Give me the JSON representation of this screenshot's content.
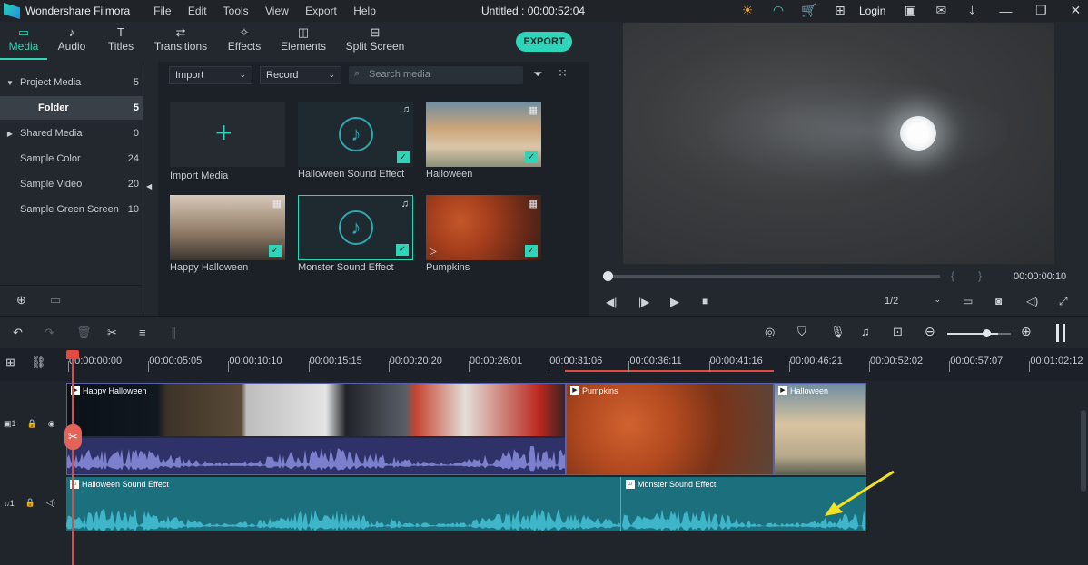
{
  "titlebar": {
    "app_name": "Wondershare Filmora",
    "menu": [
      "File",
      "Edit",
      "Tools",
      "View",
      "Export",
      "Help"
    ],
    "document": "Untitled : 00:00:52:04",
    "login": "Login"
  },
  "tabs": [
    {
      "label": "Media",
      "icon": "folder-icon"
    },
    {
      "label": "Audio",
      "icon": "music-note-icon"
    },
    {
      "label": "Titles",
      "icon": "text-icon"
    },
    {
      "label": "Transitions",
      "icon": "transition-icon"
    },
    {
      "label": "Effects",
      "icon": "effects-icon"
    },
    {
      "label": "Elements",
      "icon": "elements-icon"
    },
    {
      "label": "Split Screen",
      "icon": "split-screen-icon"
    }
  ],
  "export_label": "EXPORT",
  "sidebar": {
    "items": [
      {
        "label": "Project Media",
        "count": "5"
      },
      {
        "label": "Folder",
        "count": "5"
      },
      {
        "label": "Shared Media",
        "count": "0"
      },
      {
        "label": "Sample Color",
        "count": "24"
      },
      {
        "label": "Sample Video",
        "count": "20"
      },
      {
        "label": "Sample Green Screen",
        "count": "10"
      }
    ]
  },
  "media_toolbar": {
    "import_label": "Import",
    "record_label": "Record",
    "search_placeholder": "Search media"
  },
  "media": [
    {
      "label": "Import Media"
    },
    {
      "label": "Halloween Sound Effect"
    },
    {
      "label": "Halloween"
    },
    {
      "label": "Happy Halloween"
    },
    {
      "label": "Monster Sound Effect"
    },
    {
      "label": "Pumpkins"
    }
  ],
  "preview": {
    "time": "00:00:00:10",
    "quality": "1/2",
    "progress_fraction": 0.01
  },
  "ruler_ticks": [
    "00:00:00:00",
    "00:00:05:05",
    "00:00:10:10",
    "00:00:15:15",
    "00:00:20:20",
    "00:00:26:01",
    "00:00:31:06",
    "00:00:36:11",
    "00:00:41:16",
    "00:00:46:21",
    "00:00:52:02",
    "00:00:57:07",
    "00:01:02:12"
  ],
  "timeline": {
    "video_track_label": "1",
    "audio_track_label": "1",
    "video_clips": [
      "Happy Halloween",
      "Pumpkins",
      "Halloween"
    ],
    "audio_clips": [
      "Halloween Sound Effect",
      "Monster Sound Effect"
    ],
    "zoom_fraction": 0.8
  },
  "colors": {
    "accent": "#2fd5b8",
    "playhead": "#e04a3f",
    "audio_clip": "#1c6f7d",
    "video_audio": "#4c4f9a"
  }
}
